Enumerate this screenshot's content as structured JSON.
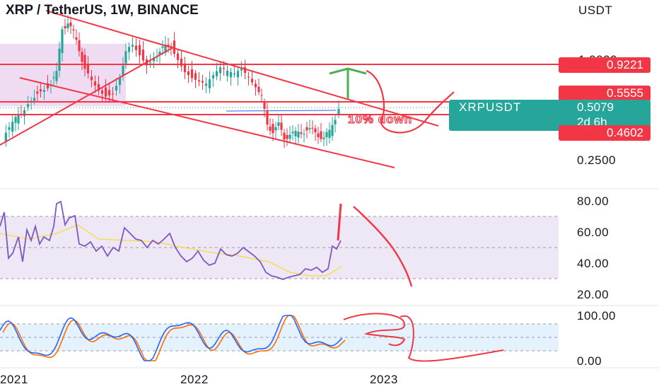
{
  "header": {
    "title": "XRP / TetherUS, 1W, BINANCE",
    "currency": "USDT"
  },
  "price_panel": {
    "partial_top_label": "1.0000",
    "tick_0250": "0.2500",
    "labels": {
      "resistance": "0.9221",
      "upper": "0.5555",
      "current": "0.5079",
      "symbol": "XRPUSDT",
      "countdown": "2d 6h",
      "support": "0.4602"
    },
    "annotation": "10% down"
  },
  "rsi_panel": {
    "ticks": [
      "80.00",
      "60.00",
      "40.00",
      "20.00"
    ]
  },
  "stoch_panel": {
    "ticks": [
      "100.00",
      "0.00"
    ]
  },
  "time_axis": {
    "labels": [
      "2021",
      "2022",
      "2023"
    ]
  },
  "colors": {
    "up": "#26a69a",
    "down": "#f23645",
    "line": "#f23645",
    "rsi": "#7e57c2",
    "rsi_ma": "#f7dc3c",
    "stoch_k": "#2962ff",
    "stoch_d": "#ff6d00",
    "rsi_band": "#ede7f6",
    "stoch_band": "#e3f2fd",
    "current_bg": "#26a69a"
  },
  "chart_data": {
    "type": "candlestick",
    "title": "XRP / TetherUS, 1W, BINANCE",
    "y_unit": "USDT",
    "y_scale": "log",
    "horizontal_levels": [
      0.9221,
      0.5555,
      0.5079,
      0.4602
    ],
    "x_labels": [
      "2021",
      "2022",
      "2023"
    ],
    "rsi_range": [
      0,
      100
    ],
    "rsi_levels": [
      70,
      50,
      30
    ],
    "stoch_range": [
      0,
      100
    ],
    "stoch_levels": [
      80,
      50,
      20
    ],
    "annotation": "10% down"
  }
}
